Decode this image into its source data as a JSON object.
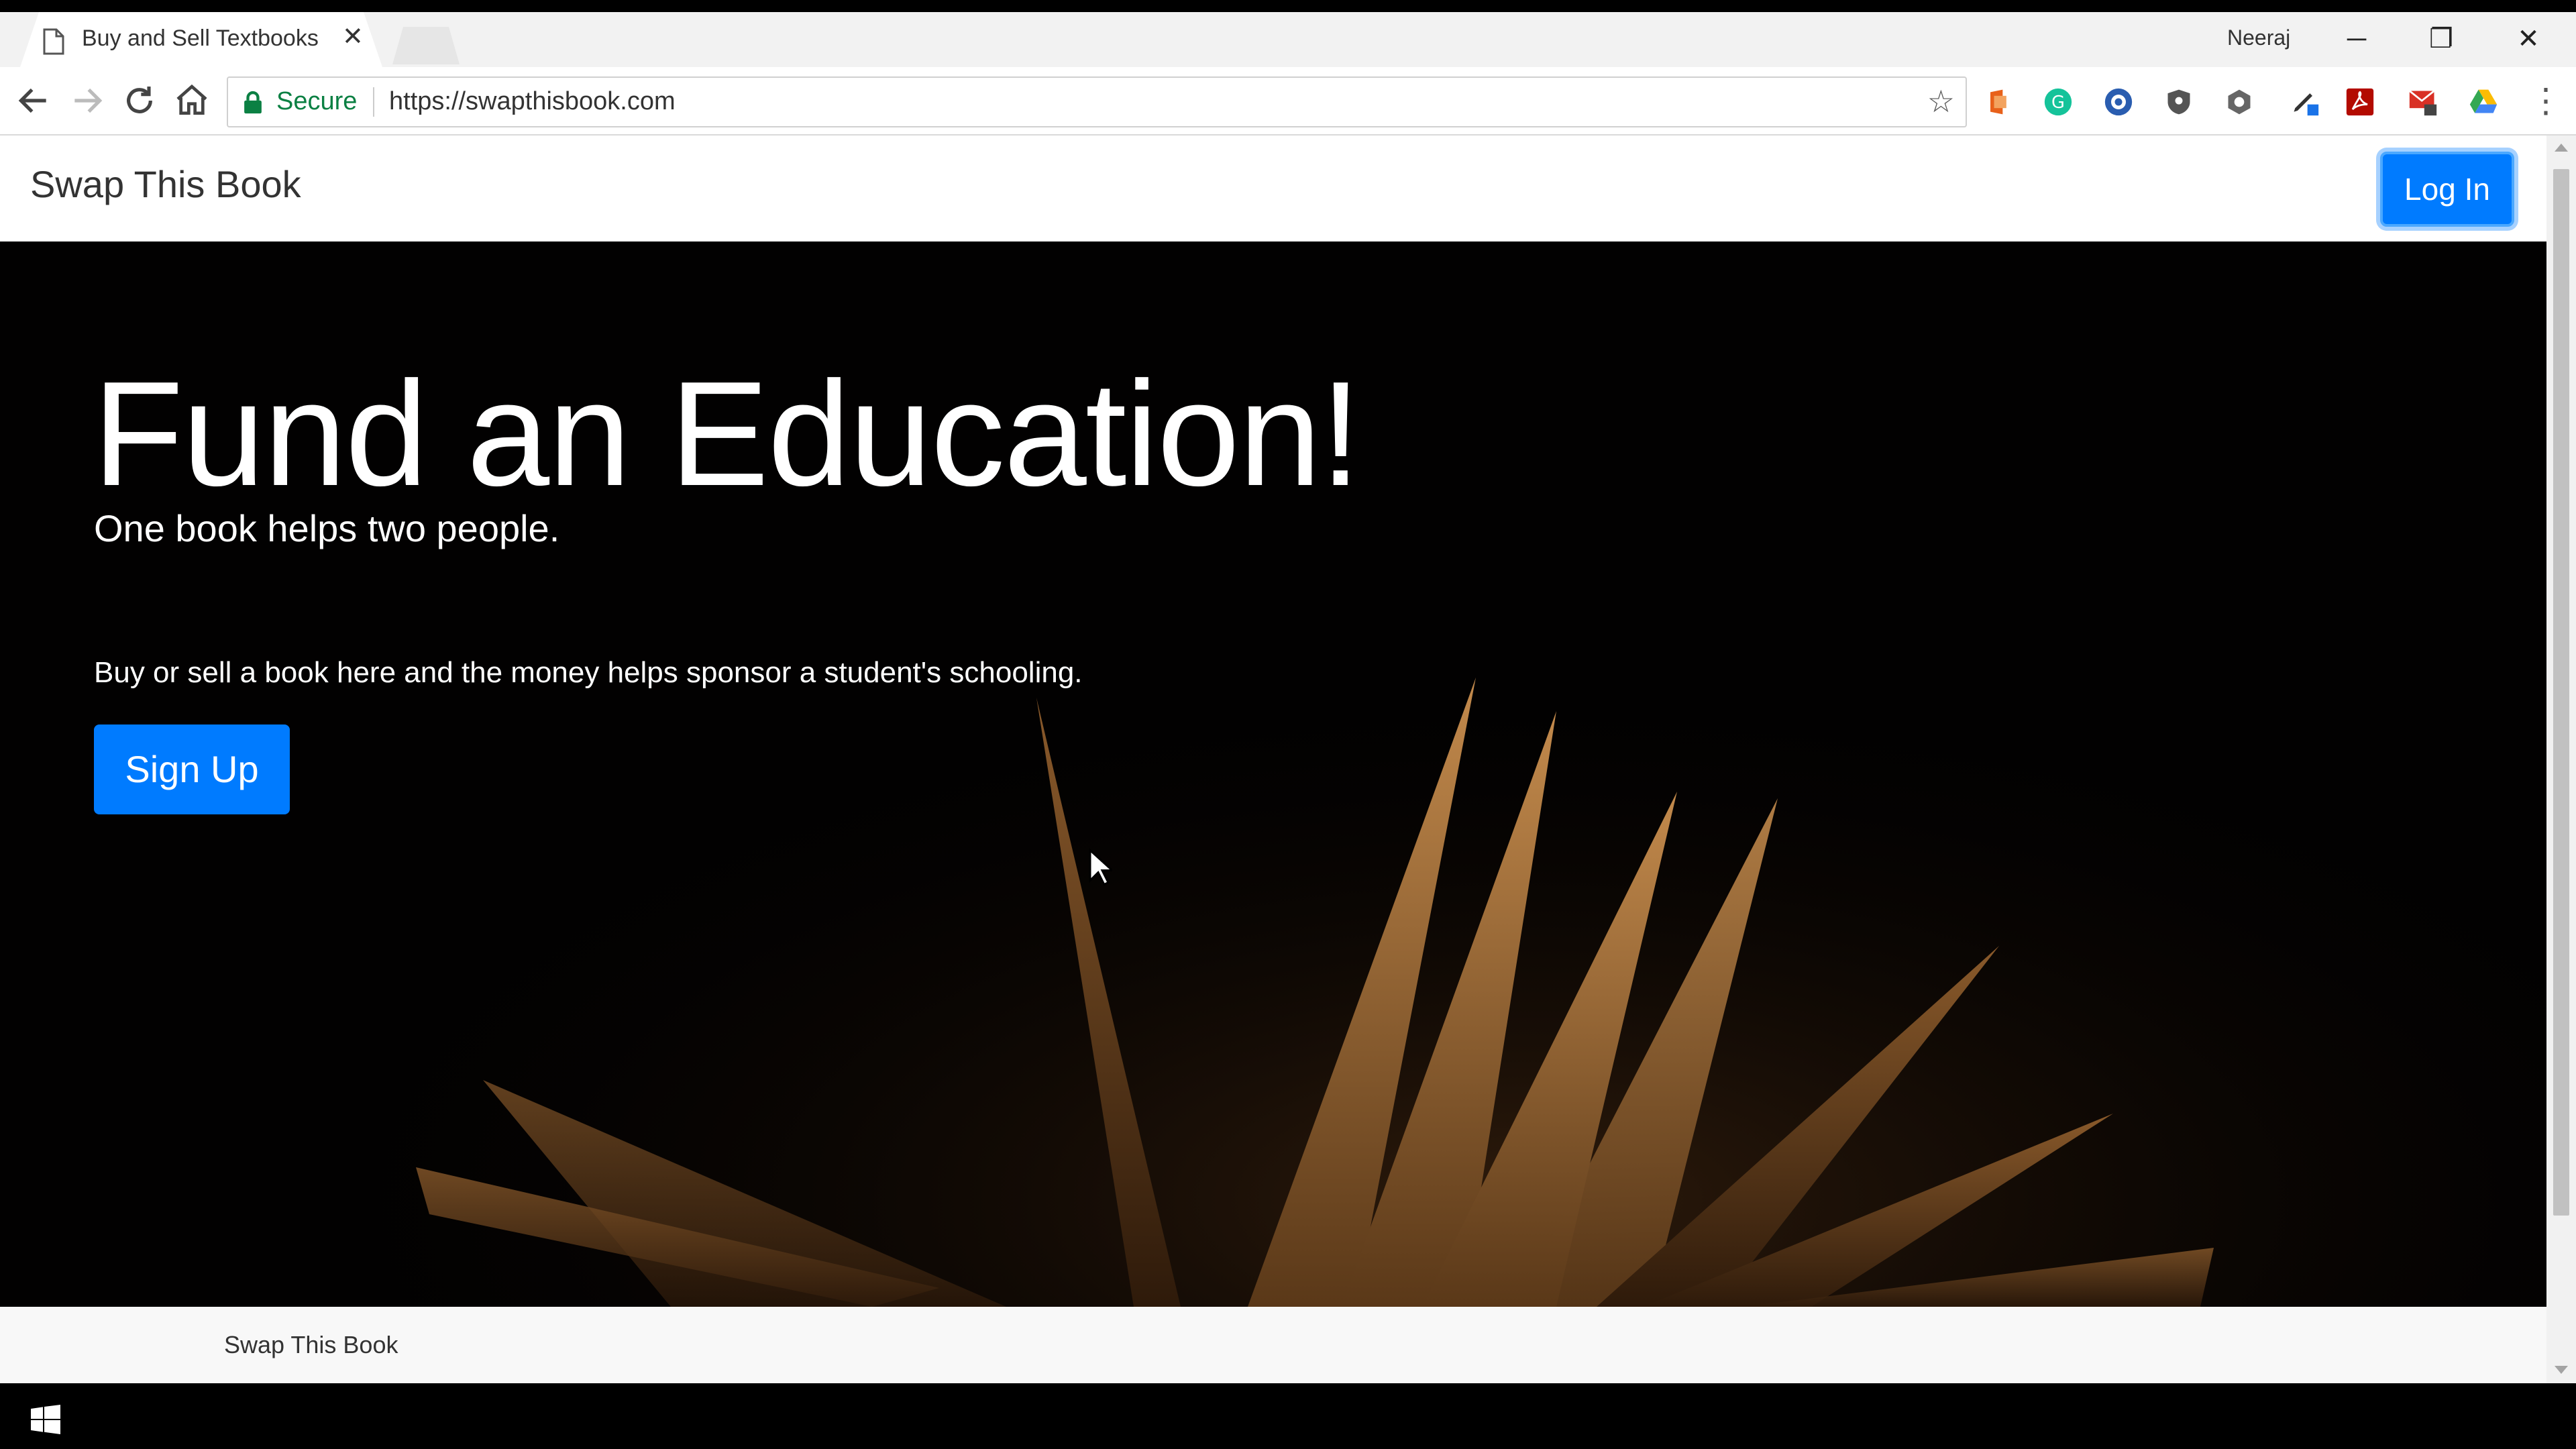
{
  "browser": {
    "tab_title": "Buy and Sell Textbooks",
    "tab_close": "✕",
    "user": "Neeraj",
    "window_controls": {
      "minimize": "─",
      "restore": "❐",
      "close": "✕"
    },
    "secure_label": "Secure",
    "url": "https://swapthisbook.com",
    "bookmark_icon": "☆",
    "menu_icon": "⋮",
    "extension_icons": [
      "office-icon",
      "grammarly-icon",
      "extension-blue-icon",
      "shield-extension-icon",
      "eye-extension-icon",
      "pen-extension-icon",
      "acrobat-icon",
      "mail-extension-icon",
      "drive-extension-icon"
    ]
  },
  "site": {
    "brand": "Swap This Book",
    "login_label": "Log In",
    "hero": {
      "title": "Fund an Education!",
      "subtitle": "One book helps two people.",
      "text": "Buy or sell a book here and the money helps sponsor a student's schooling.",
      "signup_label": "Sign Up"
    },
    "footer": "Swap This Book"
  },
  "colors": {
    "primary": "#007bff",
    "hero_bg": "#020101",
    "secure": "#0b8043"
  }
}
